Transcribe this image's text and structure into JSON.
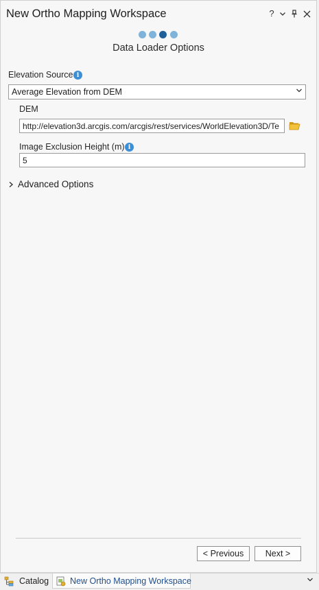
{
  "window": {
    "title": "New Ortho Mapping Workspace",
    "controls": {
      "help": "?",
      "menu": "⌄",
      "pin": "pin-icon",
      "close": "✕"
    }
  },
  "wizard": {
    "steps": [
      {
        "state": "done"
      },
      {
        "state": "done"
      },
      {
        "state": "current"
      },
      {
        "state": "pending"
      }
    ],
    "page_title": "Data Loader Options"
  },
  "form": {
    "elevation_source": {
      "label": "Elevation Source",
      "selected": "Average Elevation from DEM"
    },
    "dem": {
      "label": "DEM",
      "value": "http://elevation3d.arcgis.com/arcgis/rest/services/WorldElevation3D/Te"
    },
    "exclusion_height": {
      "label": "Image Exclusion Height (m)",
      "value": "5"
    },
    "advanced": {
      "label": "Advanced Options",
      "expanded": false
    }
  },
  "buttons": {
    "previous": "< Previous",
    "next": "Next >"
  },
  "tabs": [
    {
      "label": "Catalog",
      "selected": false
    },
    {
      "label": "New Ortho Mapping Workspace",
      "selected": true
    }
  ],
  "colors": {
    "accent": "#1f5f99",
    "info": "#3c8fd4",
    "folder": "#e0b030"
  }
}
